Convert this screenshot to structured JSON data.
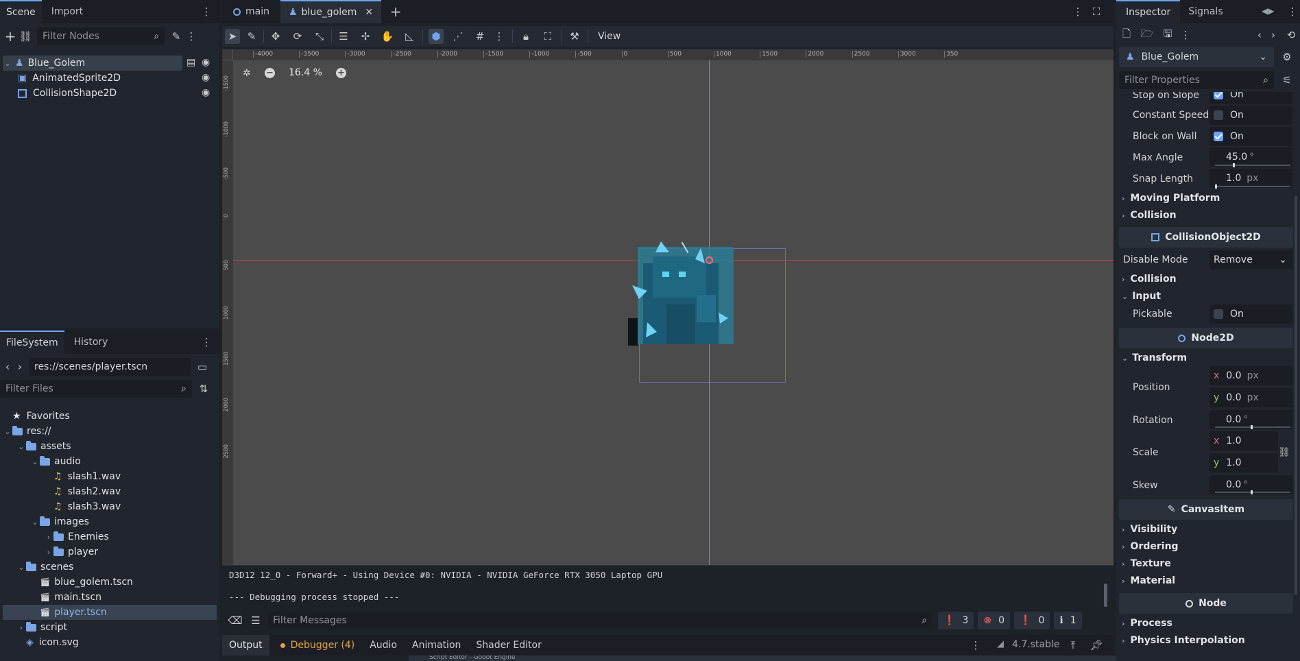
{
  "scene_dock": {
    "tabs": [
      "Scene",
      "Import"
    ],
    "filter_placeholder": "Filter Nodes",
    "nodes": [
      {
        "label": "Blue_Golem"
      },
      {
        "label": "AnimatedSprite2D"
      },
      {
        "label": "CollisionShape2D"
      }
    ]
  },
  "filesystem": {
    "tabs": [
      "FileSystem",
      "History"
    ],
    "path": "res://scenes/player.tscn",
    "filter_placeholder": "Filter Files",
    "tree": [
      {
        "label": "Favorites",
        "icon": "star-icon",
        "level": 0
      },
      {
        "label": "res://",
        "icon": "folder-icon",
        "level": 0
      },
      {
        "label": "assets",
        "icon": "folder-icon",
        "level": 1
      },
      {
        "label": "audio",
        "icon": "folder-icon",
        "level": 2
      },
      {
        "label": "slash1.wav",
        "icon": "audio-file-icon",
        "level": 3
      },
      {
        "label": "slash2.wav",
        "icon": "audio-file-icon",
        "level": 3
      },
      {
        "label": "slash3.wav",
        "icon": "audio-file-icon",
        "level": 3
      },
      {
        "label": "images",
        "icon": "folder-icon",
        "level": 2
      },
      {
        "label": "Enemies",
        "icon": "folder-icon",
        "level": 3
      },
      {
        "label": "player",
        "icon": "folder-icon",
        "level": 3
      },
      {
        "label": "scenes",
        "icon": "folder-icon",
        "level": 1
      },
      {
        "label": "blue_golem.tscn",
        "icon": "scene-file-icon",
        "level": 2
      },
      {
        "label": "main.tscn",
        "icon": "scene-file-icon",
        "level": 2
      },
      {
        "label": "player.tscn",
        "icon": "scene-file-icon",
        "level": 2,
        "selected": true
      },
      {
        "label": "script",
        "icon": "folder-icon",
        "level": 1
      },
      {
        "label": "icon.svg",
        "icon": "image-file-icon",
        "level": 1
      }
    ]
  },
  "editor_tabs": [
    {
      "label": "main"
    },
    {
      "label": "blue_golem",
      "active": true
    }
  ],
  "toolbar": {
    "view_label": "View"
  },
  "viewport": {
    "zoom": "16.4 %",
    "ruler_x": [
      "-4000",
      "-3500",
      "-3000",
      "-2500",
      "-2000",
      "-1500",
      "-1000",
      "-500",
      "0",
      "500",
      "1000",
      "1500",
      "2000",
      "2500",
      "3000",
      "350"
    ],
    "ruler_y": [
      "-1500",
      "-1000",
      "-500",
      "0",
      "500",
      "1000",
      "1500",
      "2000",
      "2500"
    ]
  },
  "output": {
    "line1": "D3D12 12_0 - Forward+ - Using Device #0: NVIDIA - NVIDIA GeForce RTX 3050 Laptop GPU",
    "line2": "--- Debugging process stopped ---",
    "filter_placeholder": "Filter Messages",
    "counts": {
      "all": "3",
      "errors": "0",
      "warnings": "0",
      "info": "1"
    }
  },
  "bottom_tabs": [
    "Output",
    "Debugger (4)",
    "Audio",
    "Animation",
    "Shader Editor"
  ],
  "version": "4.7.stable",
  "taskbar_peek": "Script Editor - Godot Engine",
  "inspector": {
    "tabs": [
      "Inspector",
      "Signals"
    ],
    "node_name": "Blue_Golem",
    "filter_placeholder": "Filter Properties",
    "props": {
      "stop_on_slope": {
        "label": "Stop on Slope",
        "value": "On"
      },
      "constant_speed": {
        "label": "Constant Speed",
        "value": "On"
      },
      "block_on_wall": {
        "label": "Block on Wall",
        "value": "On"
      },
      "max_angle": {
        "label": "Max Angle",
        "value": "45.0",
        "unit": "°"
      },
      "snap_length": {
        "label": "Snap Length",
        "value": "1.0",
        "unit": "px"
      }
    },
    "sections": {
      "moving_platform": "Moving Platform",
      "collision1": "Collision",
      "collision_object": "CollisionObject2D",
      "disable_mode_label": "Disable Mode",
      "disable_mode_value": "Remove",
      "collision2": "Collision",
      "input": "Input",
      "pickable": "Pickable",
      "pickable_value": "On",
      "node2d": "Node2D",
      "transform": "Transform",
      "position": "Position",
      "pos_x": "0.0",
      "pos_y": "0.0",
      "px": "px",
      "rotation": "Rotation",
      "rotation_value": "0.0",
      "degree": "°",
      "scale": "Scale",
      "scale_x": "1.0",
      "scale_y": "1.0",
      "skew": "Skew",
      "skew_value": "0.0",
      "canvas_item": "CanvasItem",
      "visibility": "Visibility",
      "ordering": "Ordering",
      "texture": "Texture",
      "material": "Material",
      "node": "Node",
      "process": "Process",
      "physics_interpolation": "Physics Interpolation",
      "x": "x",
      "y": "y"
    }
  }
}
